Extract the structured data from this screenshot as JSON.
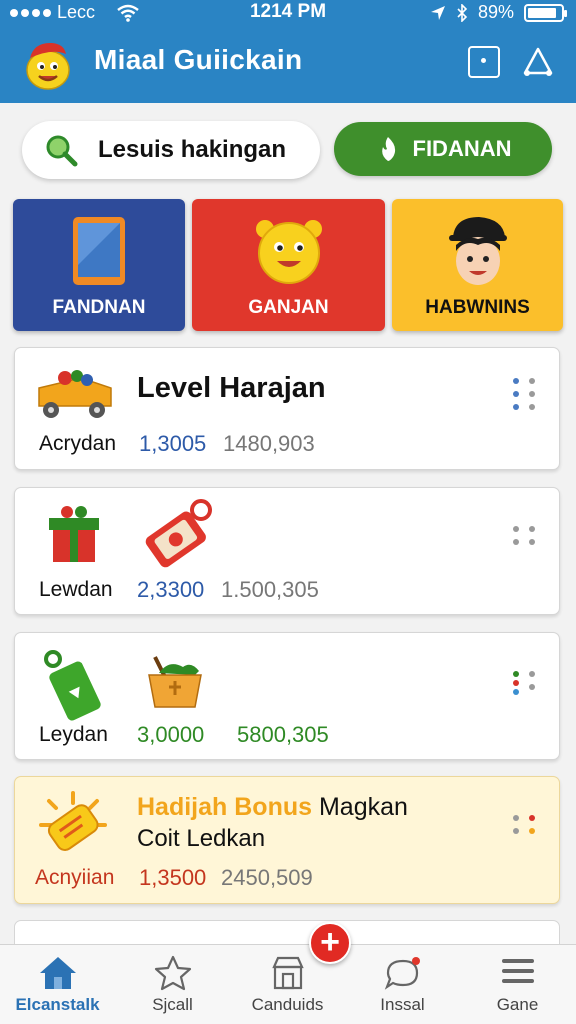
{
  "status_bar": {
    "carrier": "Lecc",
    "time": "1214 PM",
    "battery": "89%",
    "battery_level": 0.89
  },
  "header": {
    "title": "Miaal Guiickain",
    "logo_icon": "mascot-icon",
    "actions": [
      "square-icon",
      "triangle-icon"
    ]
  },
  "search": {
    "text": "Lesuis hakingan",
    "icon": "search-icon"
  },
  "action_button": {
    "label": "FIDANAN",
    "icon": "leaf-icon"
  },
  "categories": [
    {
      "label": "FANDNAN",
      "icon": "tablet-icon",
      "color": "#2e4b9a"
    },
    {
      "label": "GANJAN",
      "icon": "bear-icon",
      "color": "#e0372c"
    },
    {
      "label": "HABWNINS",
      "icon": "character-icon",
      "color": "#fbbf2b"
    }
  ],
  "cards": [
    {
      "title": "Level Harajan",
      "name": "Acrydan",
      "value_primary": "1,3005",
      "value_secondary": "1480,903",
      "primary_color": "#2d5aa8",
      "icon": "toy-truck-icon"
    },
    {
      "name": "Lewdan",
      "value_primary": "2,3300",
      "value_secondary": "1.500,305",
      "primary_color": "#2d5aa8",
      "icons": [
        "gift-icon",
        "tag-icon"
      ]
    },
    {
      "name": "Leydan",
      "value_primary": "3,0000",
      "value_secondary": "5800,305",
      "primary_color": "#2f8a25",
      "secondary_color": "#2f8a25",
      "icons": [
        "green-tag-icon",
        "basket-icon"
      ]
    },
    {
      "title_highlight": "Hadijah Bonus",
      "title_rest": "Magkan",
      "subtitle": "Coit Ledkan",
      "name": "Acnyiian",
      "value_primary": "1,3500",
      "value_secondary": "2450,509",
      "primary_color": "#c4361e",
      "icon": "sun-coupon-icon"
    }
  ],
  "bottom_nav": [
    {
      "label": "Elcanstalk",
      "icon": "home-icon",
      "active": true
    },
    {
      "label": "Sjcall",
      "icon": "star-icon",
      "active": false
    },
    {
      "label": "Canduids",
      "icon": "store-icon",
      "active": false
    },
    {
      "label": "Inssal",
      "icon": "chat-icon",
      "active": false
    },
    {
      "label": "Gane",
      "icon": "menu-icon",
      "active": false
    }
  ],
  "fab": {
    "symbol": "+"
  }
}
